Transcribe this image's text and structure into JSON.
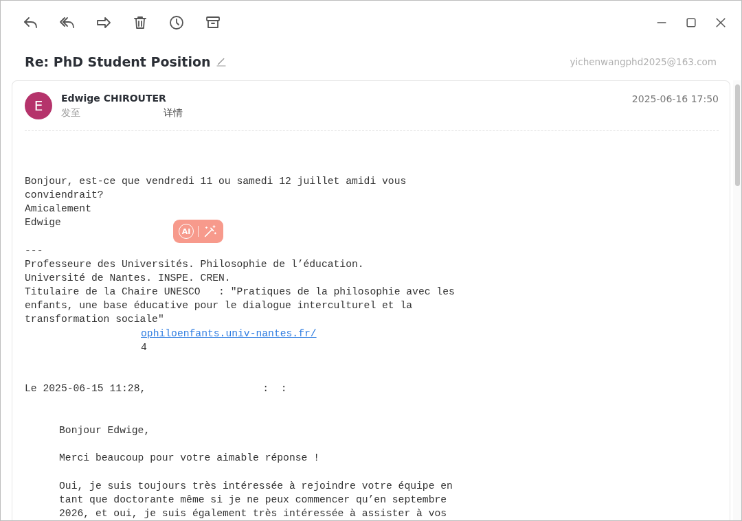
{
  "toolbar": {
    "actions": [
      {
        "kind": "reply"
      },
      {
        "kind": "reply-all"
      },
      {
        "kind": "forward"
      },
      {
        "kind": "delete"
      },
      {
        "kind": "clock"
      },
      {
        "kind": "archive"
      }
    ]
  },
  "window_controls": [
    {
      "kind": "minimize"
    },
    {
      "kind": "maximize"
    },
    {
      "kind": "close"
    }
  ],
  "subject": "Re: PhD Student Position",
  "account": "yichenwangphd2025@163.com",
  "message": {
    "avatar_letter": "E",
    "sender": "Edwige CHIROUTER",
    "to_label": "发至",
    "details_link": "详情",
    "date": "2025-06-16 17:50"
  },
  "ai_badge": {
    "label": "AI"
  },
  "body": [
    {
      "kind": "blank"
    },
    {
      "kind": "blank"
    },
    {
      "kind": "blank"
    },
    {
      "kind": "text",
      "text": "Bonjour, est-ce que vendredi 11 ou samedi 12 juillet amidi vous"
    },
    {
      "kind": "text",
      "text": "conviendrait?"
    },
    {
      "kind": "text",
      "text": "Amicalement"
    },
    {
      "kind": "text",
      "text": "Edwige"
    },
    {
      "kind": "blank"
    },
    {
      "kind": "text",
      "text": "---"
    },
    {
      "kind": "text",
      "text": "Professeure des Universités. Philosophie de l’éducation."
    },
    {
      "kind": "text",
      "text": "Université de Nantes. INSPE. CREN."
    },
    {
      "kind": "text",
      "text": "Titulaire de la Chaire UNESCO   : ″Pratiques de la philosophie avec les"
    },
    {
      "kind": "text",
      "text": "enfants, une base éducative pour le dialogue interculturel et la"
    },
    {
      "kind": "text",
      "text": "transformation sociale″"
    },
    {
      "kind": "link",
      "text": "ophiloenfants.univ-nantes.fr/"
    },
    {
      "kind": "offset",
      "text": "4"
    },
    {
      "kind": "blank"
    },
    {
      "kind": "blank"
    },
    {
      "kind": "text",
      "text": "Le 2025-06-15 11:28,",
      "tail": ":  :"
    },
    {
      "kind": "blank"
    },
    {
      "kind": "blank"
    },
    {
      "kind": "quote",
      "text": "Bonjour Edwige,"
    },
    {
      "kind": "blank"
    },
    {
      "kind": "quote",
      "text": "Merci beaucoup pour votre aimable réponse !"
    },
    {
      "kind": "blank"
    },
    {
      "kind": "quote",
      "text": "Oui, je suis toujours très intéressée à rejoindre votre équipe en"
    },
    {
      "kind": "quote",
      "text": "tant que doctorante même si je ne peux commencer qu’en septembre"
    },
    {
      "kind": "quote",
      "text": "2026, et oui, je suis également très intéressée à assister à vos"
    }
  ]
}
